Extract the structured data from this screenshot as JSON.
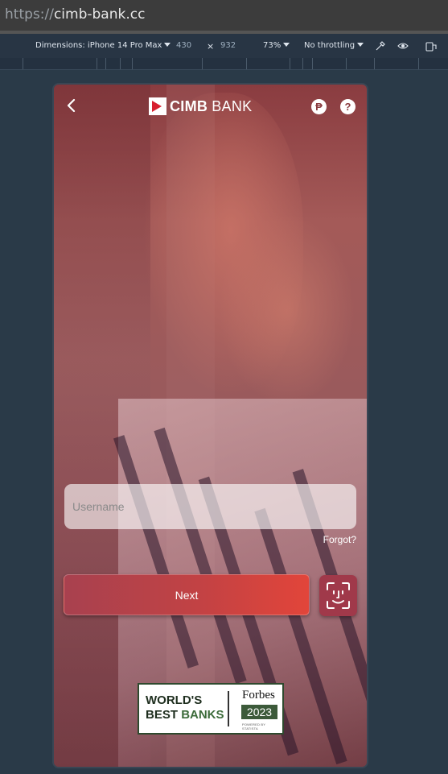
{
  "browser": {
    "url_protocol": "https://",
    "url_host": "cimb-bank.cc"
  },
  "devtools": {
    "device": "Dimensions: iPhone 14 Pro Max",
    "width": "430",
    "times": "×",
    "height": "932",
    "zoom": "73%",
    "throttling": "No throttling"
  },
  "app": {
    "brand_bold": "CIMB",
    "brand_light": "BANK",
    "currency_icon_glyph": "₱",
    "help_icon_glyph": "?",
    "username_placeholder": "Username",
    "username_value": "",
    "forgot_label": "Forgot?",
    "next_label": "Next",
    "badge": {
      "line1": "WORLD'S",
      "line2a": "BEST",
      "line2b": "BANKS",
      "forbes": "Forbes",
      "year": "2023",
      "powered": "POWERED BY STATISTA"
    },
    "colors": {
      "brand_red": "#d7202f",
      "next_start": "#a8414f",
      "next_end": "#e2453a",
      "faceid_bg": "#a0394a"
    }
  }
}
